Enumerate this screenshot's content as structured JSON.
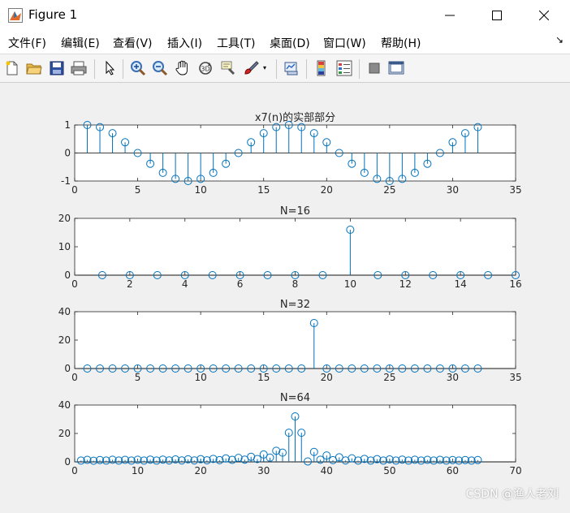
{
  "window": {
    "title": "Figure 1"
  },
  "menu": [
    {
      "label": "文件(F)"
    },
    {
      "label": "编辑(E)"
    },
    {
      "label": "查看(V)"
    },
    {
      "label": "插入(I)"
    },
    {
      "label": "工具(T)"
    },
    {
      "label": "桌面(D)"
    },
    {
      "label": "窗口(W)"
    },
    {
      "label": "帮助(H)"
    }
  ],
  "toolbar": {
    "icons": [
      "new-figure-icon",
      "open-file-icon",
      "save-icon",
      "print-icon",
      "pointer-icon",
      "zoom-in-icon",
      "zoom-out-icon",
      "pan-hand-icon",
      "rotate-3d-icon",
      "data-cursor-icon",
      "brush-icon",
      "link-plot-icon",
      "colorbar-icon",
      "legend-icon",
      "hide-plot-tools-icon",
      "show-plot-tools-icon"
    ]
  },
  "watermark": "CSDN @渔人老刘",
  "colors": {
    "stem": "#0072bd",
    "axes": "#262626",
    "figure_bg": "#f0f0f0"
  },
  "chart_data": [
    {
      "type": "stem",
      "title": "x7(n)的实部部分",
      "xlim": [
        0,
        35
      ],
      "ylim": [
        -1,
        1
      ],
      "xticks": [
        0,
        5,
        10,
        15,
        20,
        25,
        30,
        35
      ],
      "yticks": [
        -1,
        0,
        1
      ],
      "x": [
        1,
        2,
        3,
        4,
        5,
        6,
        7,
        8,
        9,
        10,
        11,
        12,
        13,
        14,
        15,
        16,
        17,
        18,
        19,
        20,
        21,
        22,
        23,
        24,
        25,
        26,
        27,
        28,
        29,
        30,
        31,
        32
      ],
      "y": [
        1.0,
        0.924,
        0.707,
        0.383,
        0.0,
        -0.383,
        -0.707,
        -0.924,
        -1.0,
        -0.924,
        -0.707,
        -0.383,
        0.0,
        0.383,
        0.707,
        0.924,
        1.0,
        0.924,
        0.707,
        0.383,
        0.0,
        -0.383,
        -0.707,
        -0.924,
        -1.0,
        -0.924,
        -0.707,
        -0.383,
        0.0,
        0.383,
        0.707,
        0.924
      ]
    },
    {
      "type": "stem",
      "title": "N=16",
      "xlim": [
        0,
        16
      ],
      "ylim": [
        0,
        20
      ],
      "xticks": [
        0,
        2,
        4,
        6,
        8,
        10,
        12,
        14,
        16
      ],
      "yticks": [
        0,
        10,
        20
      ],
      "x": [
        1,
        2,
        3,
        4,
        5,
        6,
        7,
        8,
        9,
        10,
        11,
        12,
        13,
        14,
        15,
        16
      ],
      "y": [
        0,
        0,
        0,
        0,
        0,
        0,
        0,
        0,
        0,
        16,
        0,
        0,
        0,
        0,
        0,
        0
      ]
    },
    {
      "type": "stem",
      "title": "N=32",
      "xlim": [
        0,
        35
      ],
      "ylim": [
        0,
        40
      ],
      "xticks": [
        0,
        5,
        10,
        15,
        20,
        25,
        30,
        35
      ],
      "yticks": [
        0,
        20,
        40
      ],
      "x": [
        1,
        2,
        3,
        4,
        5,
        6,
        7,
        8,
        9,
        10,
        11,
        12,
        13,
        14,
        15,
        16,
        17,
        18,
        19,
        20,
        21,
        22,
        23,
        24,
        25,
        26,
        27,
        28,
        29,
        30,
        31,
        32
      ],
      "y": [
        0,
        0,
        0,
        0,
        0,
        0,
        0,
        0,
        0,
        0,
        0,
        0,
        0,
        0,
        0,
        0,
        0,
        0,
        32,
        0,
        0,
        0,
        0,
        0,
        0,
        0,
        0,
        0,
        0,
        0,
        0,
        0
      ]
    },
    {
      "type": "stem",
      "title": "N=64",
      "xlim": [
        0,
        70
      ],
      "ylim": [
        0,
        40
      ],
      "xticks": [
        0,
        10,
        20,
        30,
        40,
        50,
        60,
        70
      ],
      "yticks": [
        0,
        20,
        40
      ],
      "x": [
        1,
        2,
        3,
        4,
        5,
        6,
        7,
        8,
        9,
        10,
        11,
        12,
        13,
        14,
        15,
        16,
        17,
        18,
        19,
        20,
        21,
        22,
        23,
        24,
        25,
        26,
        27,
        28,
        29,
        30,
        31,
        32,
        33,
        34,
        35,
        36,
        37,
        38,
        39,
        40,
        41,
        42,
        43,
        44,
        45,
        46,
        47,
        48,
        49,
        50,
        51,
        52,
        53,
        54,
        55,
        56,
        57,
        58,
        59,
        60,
        61,
        62,
        63,
        64
      ],
      "y": [
        0.9,
        1.4,
        0.8,
        1.3,
        0.9,
        1.5,
        0.9,
        1.4,
        0.9,
        1.5,
        0.9,
        1.6,
        0.9,
        1.6,
        1.0,
        1.7,
        1.0,
        1.8,
        1.0,
        1.9,
        1.1,
        2.1,
        1.2,
        2.4,
        1.4,
        2.8,
        1.6,
        3.6,
        2.0,
        5.2,
        3.0,
        7.8,
        6.5,
        20.5,
        32.0,
        20.5,
        0.3,
        7.0,
        1.5,
        4.5,
        1.2,
        3.2,
        1.0,
        2.5,
        0.9,
        2.1,
        0.9,
        1.9,
        0.9,
        1.7,
        0.9,
        1.6,
        0.9,
        1.5,
        0.9,
        1.4,
        0.9,
        1.4,
        0.9,
        1.3,
        0.9,
        1.3,
        0.9,
        1.3
      ]
    }
  ]
}
